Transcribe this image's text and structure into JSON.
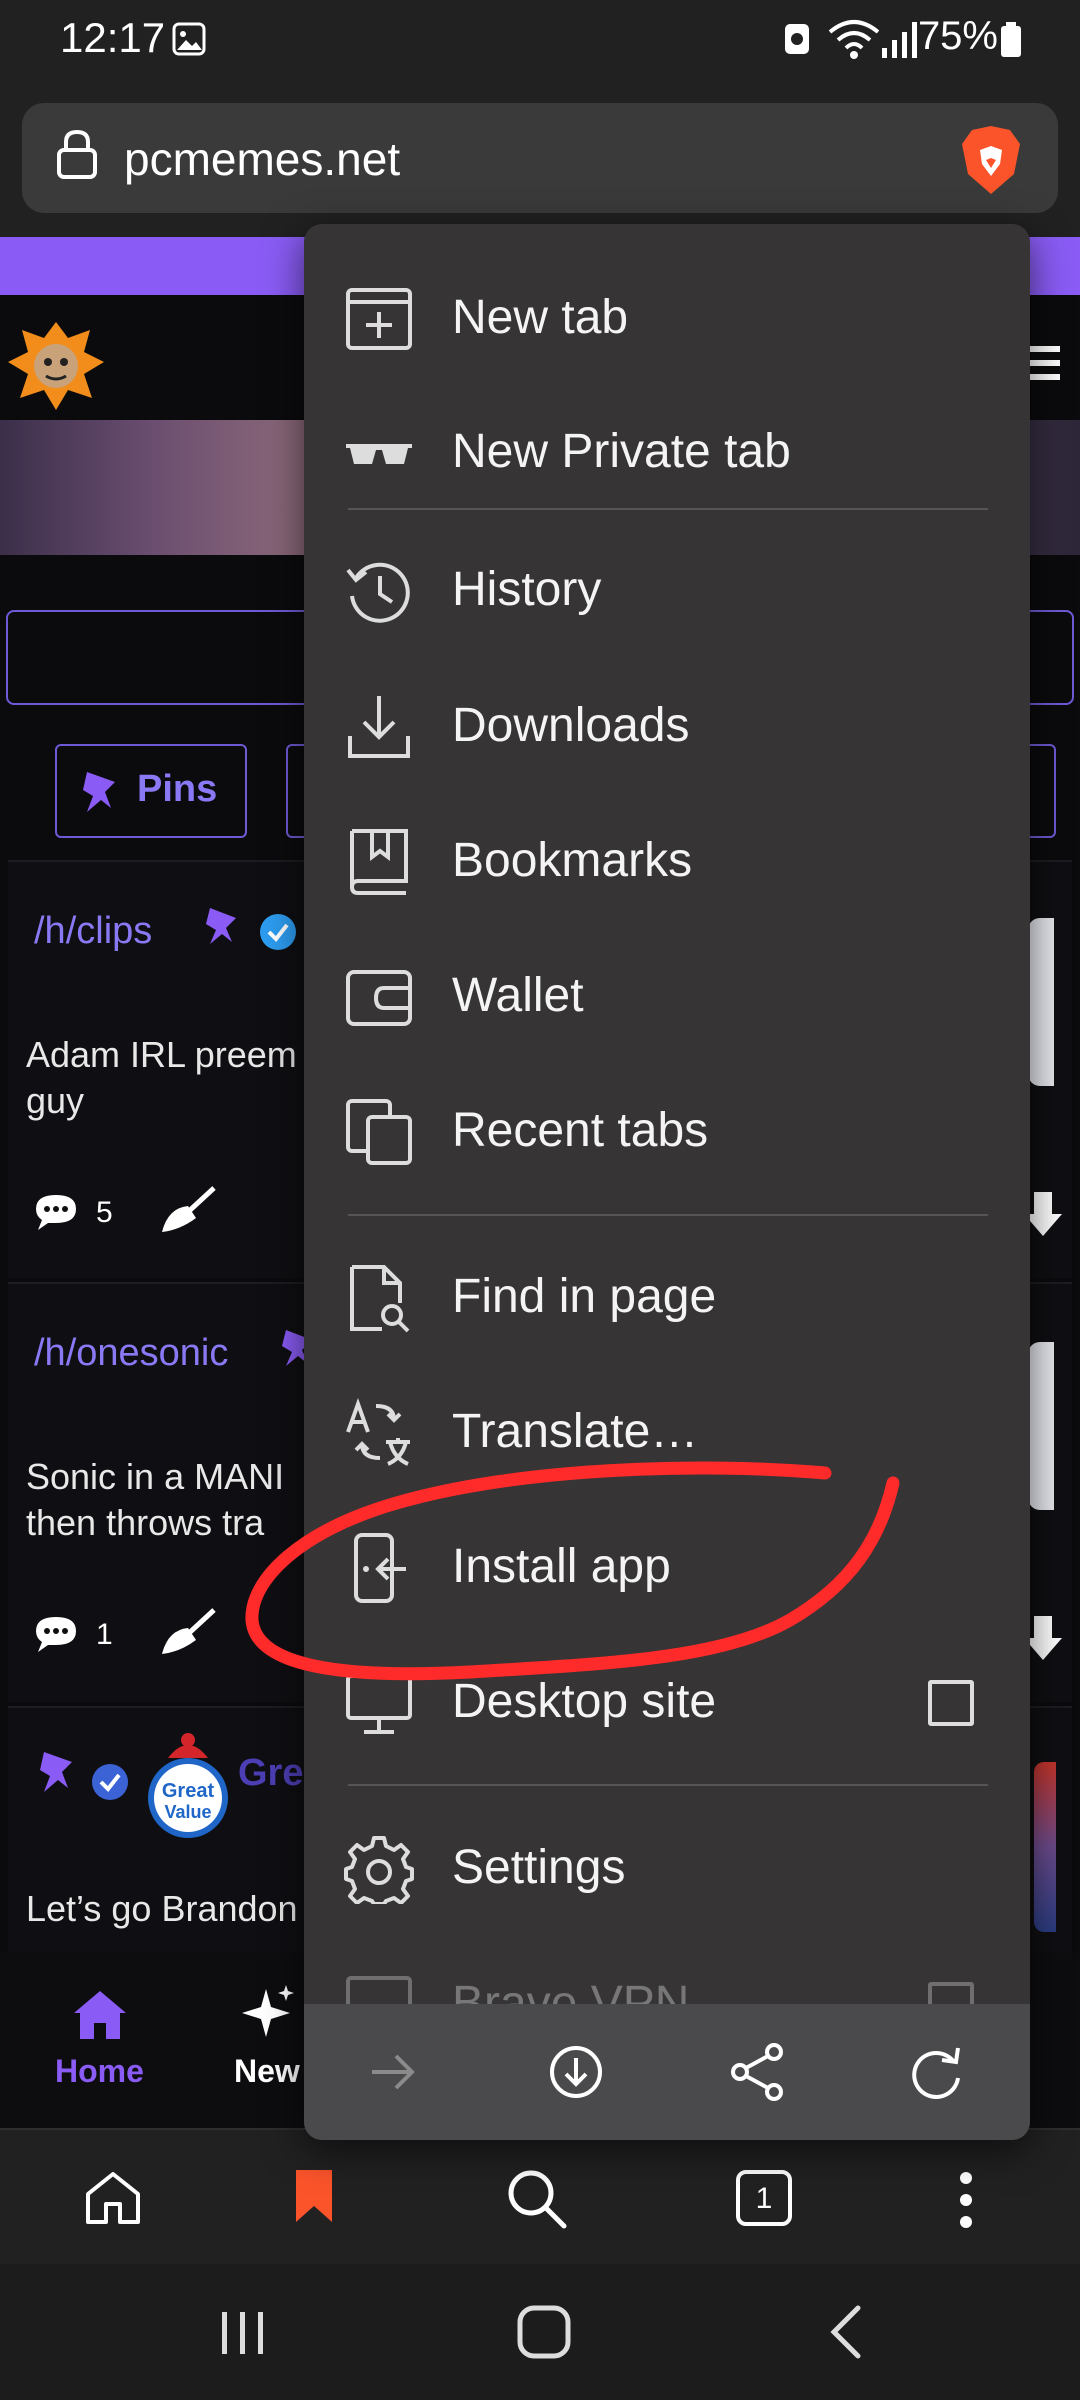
{
  "status_bar": {
    "time": "12:17",
    "battery": "75%"
  },
  "url_bar": {
    "url": "pcmemes.net"
  },
  "page": {
    "pins_label": "Pins",
    "posts": [
      {
        "sub": "/h/clips",
        "text1": "Adam IRL preem",
        "text2": "guy",
        "comments": "5"
      },
      {
        "sub": "/h/onesonic",
        "text1": "Sonic in a MANI",
        "text2": "then throws tra",
        "comments": "1"
      },
      {
        "user": "Grea",
        "avatar_line1": "Great",
        "avatar_line2": "Value",
        "text1": "Let’s go Brandon"
      }
    ],
    "nav": {
      "home": "Home",
      "new": "New"
    }
  },
  "menu": {
    "items": [
      {
        "label": "New tab",
        "icon": "new-tab-icon"
      },
      {
        "label": "New Private tab",
        "icon": "private-glasses-icon"
      },
      {
        "label": "History",
        "icon": "history-icon"
      },
      {
        "label": "Downloads",
        "icon": "download-icon"
      },
      {
        "label": "Bookmarks",
        "icon": "bookmark-book-icon"
      },
      {
        "label": "Wallet",
        "icon": "wallet-icon"
      },
      {
        "label": "Recent tabs",
        "icon": "recent-tabs-icon"
      },
      {
        "label": "Find in page",
        "icon": "find-in-page-icon"
      },
      {
        "label": "Translate…",
        "icon": "translate-icon"
      },
      {
        "label": "Install app",
        "icon": "install-app-icon"
      },
      {
        "label": "Desktop site",
        "icon": "desktop-icon"
      },
      {
        "label": "Settings",
        "icon": "settings-gear-icon"
      },
      {
        "label": "Brave VPN",
        "icon": "vpn-icon"
      }
    ],
    "desktop_site_checked": false
  },
  "toolbar": {
    "tab_count": "1"
  },
  "colors": {
    "accent": "#8a5cf5",
    "brave_orange": "#fb542b",
    "annotation": "#ff2a2a"
  }
}
